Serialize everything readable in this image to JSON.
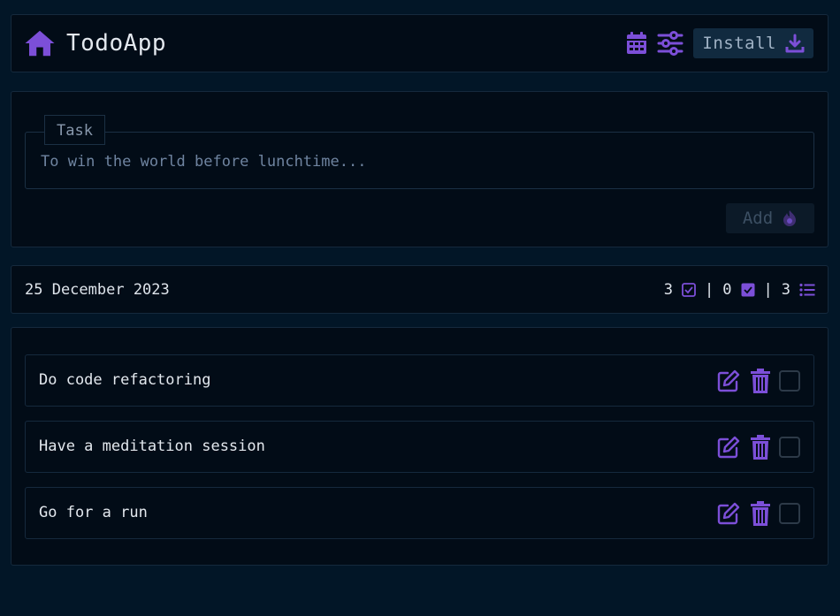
{
  "app": {
    "title": "TodoApp"
  },
  "header": {
    "install_label": "Install",
    "icons": [
      "home-icon",
      "calendar-icon",
      "sliders-icon",
      "download-icon"
    ]
  },
  "form": {
    "legend": "Task",
    "input_placeholder": "To win the world before lunchtime...",
    "input_value": "",
    "add_label": "Add"
  },
  "summary": {
    "date": "25 December 2023",
    "remaining_count": "3",
    "separator": "|",
    "done_count": "0",
    "total_count": "3"
  },
  "tasks": [
    {
      "text": "Do code refactoring",
      "done": false
    },
    {
      "text": "Have a meditation session",
      "done": false
    },
    {
      "text": "Go for a run",
      "done": false
    }
  ],
  "colors": {
    "accent": "#7c4fd8",
    "background": "#021627",
    "card": "#020c17",
    "border": "#15293d"
  }
}
